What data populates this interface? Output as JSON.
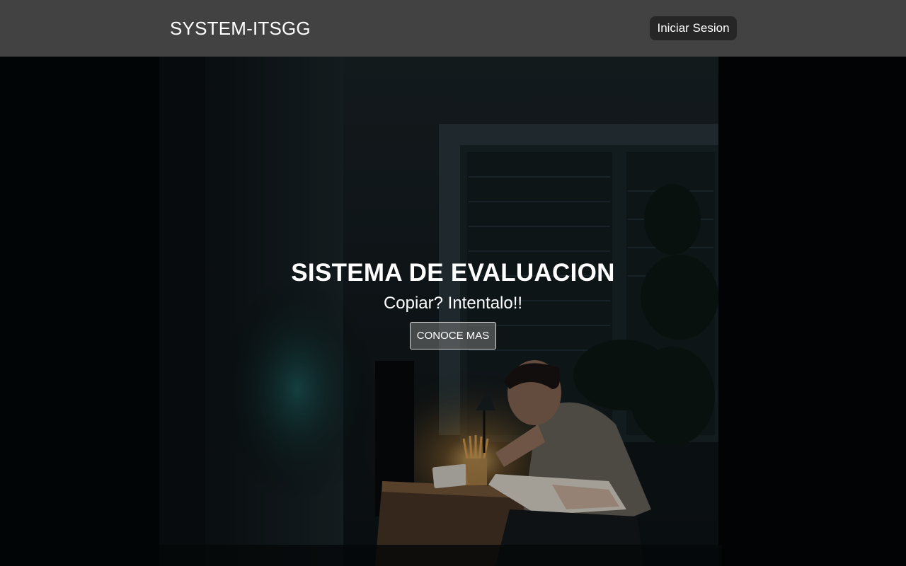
{
  "navbar": {
    "brand": "SYSTEM-ITSGG",
    "login_label": "Iniciar Sesion"
  },
  "hero": {
    "title": "SISTEMA DE EVALUACION",
    "subtitle": "Copiar? Intentalo!!",
    "cta_label": "CONOCE MAS",
    "background_description": "person-studying-at-desk-lamp-photo"
  },
  "colors": {
    "navbar_bg": "#424242",
    "login_btn_bg": "#262626",
    "text": "#ffffff",
    "hero_bg": "#05090a"
  }
}
